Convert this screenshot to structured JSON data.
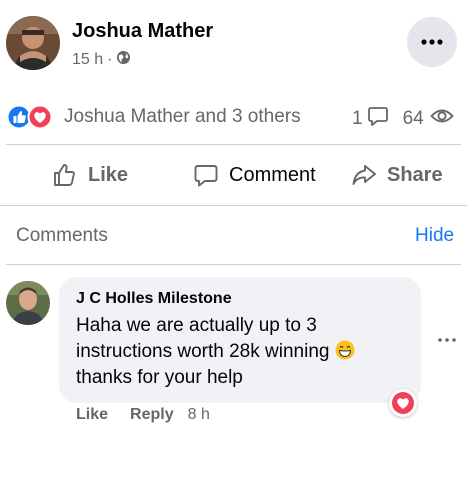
{
  "post": {
    "author": "Joshua Mather",
    "time": "15 h",
    "separator": "·",
    "privacy_icon": "globe-icon",
    "reactions_text": "Joshua Mather and 3 others",
    "comment_count": "1",
    "view_count": "64"
  },
  "actions": {
    "like": "Like",
    "comment": "Comment",
    "share": "Share"
  },
  "comments_section": {
    "title": "Comments",
    "hide": "Hide"
  },
  "comment": {
    "author": "J C Holles Milestone",
    "text": "Haha we are actually up to 3 instructions worth 28k winning",
    "text_end": "thanks for your help",
    "like": "Like",
    "reply": "Reply",
    "time": "8 h"
  },
  "colors": {
    "blue": "#1877f2",
    "love": "#f33e58",
    "secondary_text": "#65676b",
    "bubble": "#f0f2f5"
  }
}
